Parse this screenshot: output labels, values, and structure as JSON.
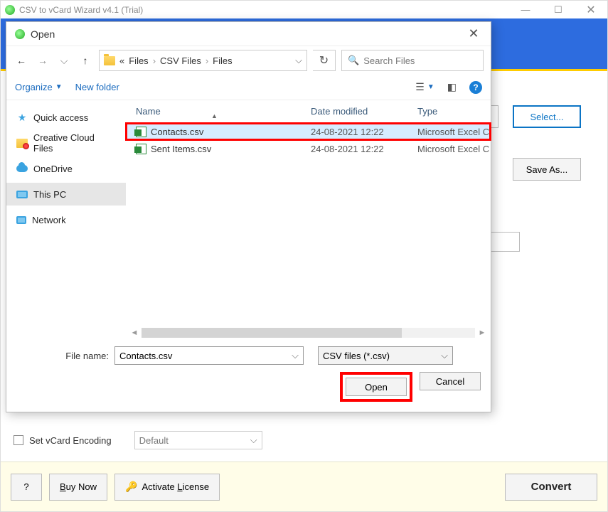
{
  "app": {
    "title": "CSV to vCard Wizard v4.1 (Trial)"
  },
  "main": {
    "select_btn": "Select...",
    "saveas_btn": "Save As...",
    "encoding_label": "Set vCard Encoding",
    "encoding_value": "Default",
    "help_btn": "?",
    "buy_btn_prefix": "B",
    "buy_btn_rest": "uy Now",
    "activate_btn_prefix": "Activate ",
    "activate_btn_u": "L",
    "activate_btn_rest": "icense",
    "convert_btn": "Convert"
  },
  "dlg": {
    "title": "Open",
    "back_enabled": true,
    "breadcrumb": {
      "prefix": "«",
      "parts": [
        "Files",
        "CSV Files",
        "Files"
      ]
    },
    "search_placeholder": "Search Files",
    "organize": "Organize",
    "new_folder": "New folder",
    "help_glyph": "?",
    "sidebar": [
      {
        "label": "Quick access",
        "icon": "star"
      },
      {
        "label": "Creative Cloud Files",
        "icon": "cc"
      },
      {
        "label": "OneDrive",
        "icon": "cloud"
      },
      {
        "label": "This PC",
        "icon": "pc",
        "selected": true
      },
      {
        "label": "Network",
        "icon": "net"
      }
    ],
    "columns": {
      "name": "Name",
      "date": "Date modified",
      "type": "Type"
    },
    "files": [
      {
        "name": "Contacts.csv",
        "date": "24-08-2021 12:22",
        "type": "Microsoft Excel C",
        "selected": true,
        "highlight": true
      },
      {
        "name": "Sent Items.csv",
        "date": "24-08-2021 12:22",
        "type": "Microsoft Excel C"
      }
    ],
    "filename_label": "File name:",
    "filename_value": "Contacts.csv",
    "filetype_value": "CSV files (*.csv)",
    "open_btn": "Open",
    "cancel_btn": "Cancel"
  }
}
